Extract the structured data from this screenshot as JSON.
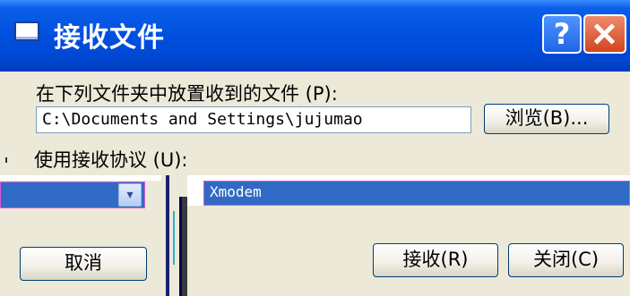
{
  "window": {
    "title": "接收文件",
    "help_glyph": "?",
    "icons": [
      "window-icon",
      "help-icon",
      "close-icon"
    ]
  },
  "folder": {
    "label": "在下列文件夹中放置收到的文件 (P):",
    "path": "C:\\Documents and Settings\\jujumao"
  },
  "browse_button": "浏览(B)...",
  "protocol": {
    "label": "使用接收协议 (U):",
    "list_selected": "Xmodem",
    "dropdown_arrow": "▾"
  },
  "buttons": {
    "cancel": "取消",
    "accept": "接收(R)",
    "close": "关闭(C)"
  },
  "colors": {
    "titlebar": "#0050e0",
    "selection": "#316ac5",
    "face": "#ece9d8"
  }
}
